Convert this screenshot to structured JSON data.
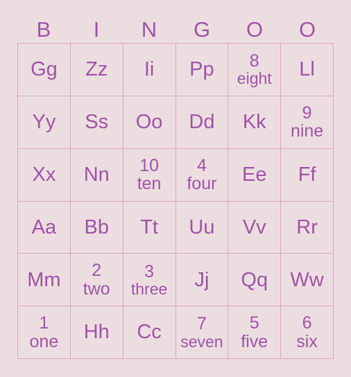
{
  "colors": {
    "background": "#ecdee0",
    "text": "#a052a8",
    "border": "#d9a1cb"
  },
  "header": {
    "letters": [
      "B",
      "I",
      "N",
      "G",
      "O",
      "O"
    ]
  },
  "grid": {
    "columns": 6,
    "rows": 6,
    "cells": [
      {
        "line1": "Gg",
        "line2": ""
      },
      {
        "line1": "Zz",
        "line2": ""
      },
      {
        "line1": "Ii",
        "line2": ""
      },
      {
        "line1": "Pp",
        "line2": ""
      },
      {
        "line1": "8",
        "line2": "eight"
      },
      {
        "line1": "Ll",
        "line2": ""
      },
      {
        "line1": "Yy",
        "line2": ""
      },
      {
        "line1": "Ss",
        "line2": ""
      },
      {
        "line1": "Oo",
        "line2": ""
      },
      {
        "line1": "Dd",
        "line2": ""
      },
      {
        "line1": "Kk",
        "line2": ""
      },
      {
        "line1": "9",
        "line2": "nine"
      },
      {
        "line1": "Xx",
        "line2": ""
      },
      {
        "line1": "Nn",
        "line2": ""
      },
      {
        "line1": "10",
        "line2": "ten"
      },
      {
        "line1": "4",
        "line2": "four"
      },
      {
        "line1": "Ee",
        "line2": ""
      },
      {
        "line1": "Ff",
        "line2": ""
      },
      {
        "line1": "Aa",
        "line2": ""
      },
      {
        "line1": "Bb",
        "line2": ""
      },
      {
        "line1": "Tt",
        "line2": ""
      },
      {
        "line1": "Uu",
        "line2": ""
      },
      {
        "line1": "Vv",
        "line2": ""
      },
      {
        "line1": "Rr",
        "line2": ""
      },
      {
        "line1": "Mm",
        "line2": ""
      },
      {
        "line1": "2",
        "line2": "two"
      },
      {
        "line1": "3",
        "line2": "three"
      },
      {
        "line1": "Jj",
        "line2": ""
      },
      {
        "line1": "Qq",
        "line2": ""
      },
      {
        "line1": "Ww",
        "line2": ""
      },
      {
        "line1": "1",
        "line2": "one"
      },
      {
        "line1": "Hh",
        "line2": ""
      },
      {
        "line1": "Cc",
        "line2": ""
      },
      {
        "line1": "7",
        "line2": "seven"
      },
      {
        "line1": "5",
        "line2": "five"
      },
      {
        "line1": "6",
        "line2": "six"
      }
    ]
  }
}
